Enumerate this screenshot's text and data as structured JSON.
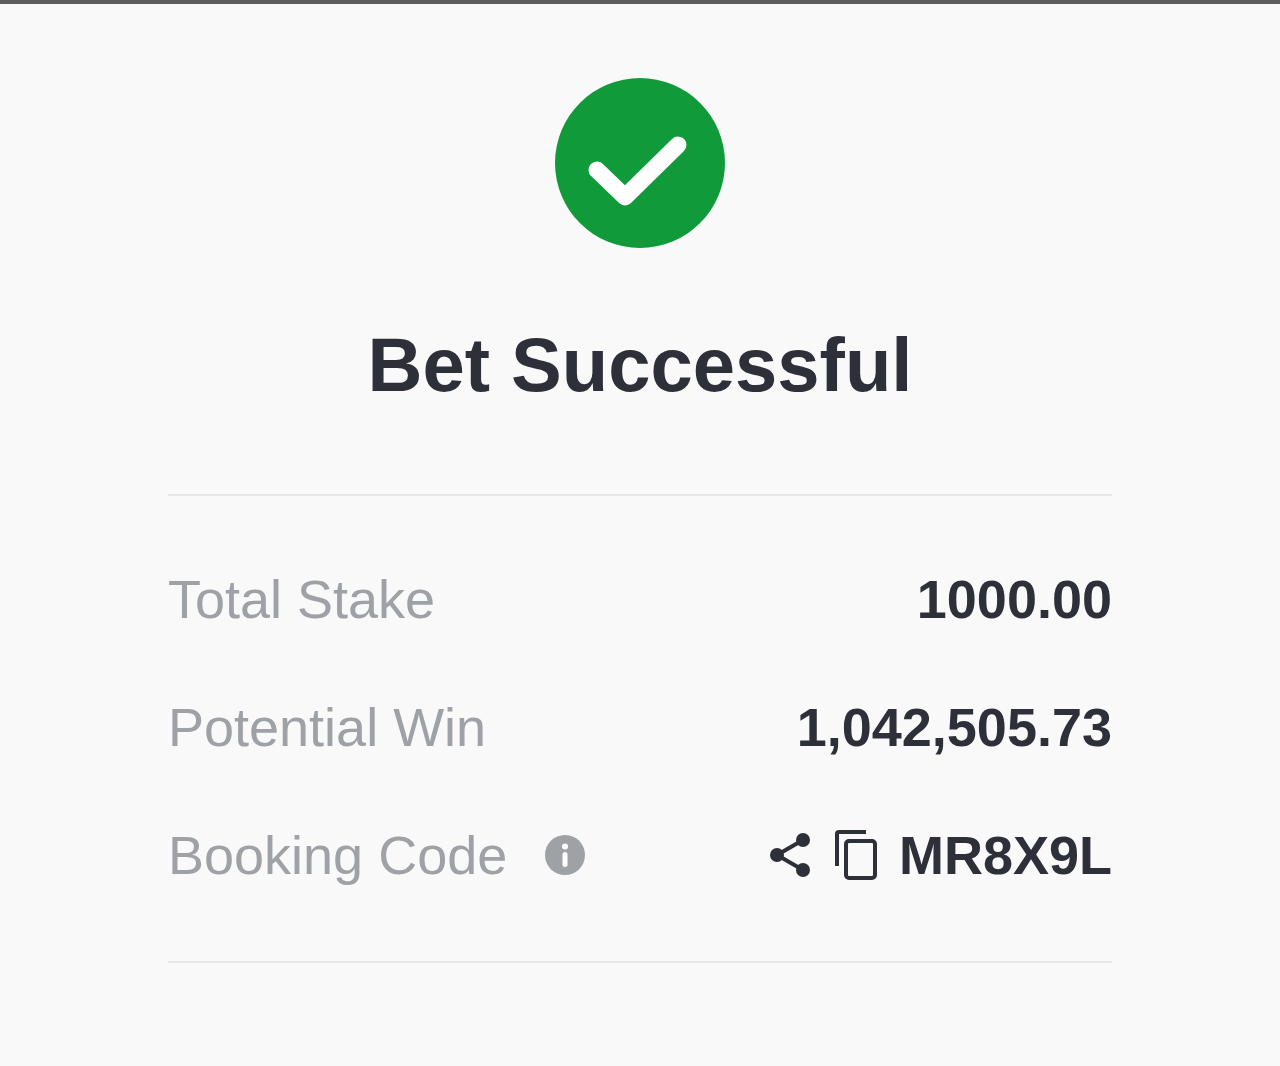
{
  "status": {
    "kind": "success",
    "title": "Bet Successful"
  },
  "details": [
    {
      "kind": "amount",
      "label": "Total Stake",
      "value": "1000.00"
    },
    {
      "kind": "amount",
      "label": "Potential Win",
      "value": "1,042,505.73"
    },
    {
      "kind": "code",
      "label": "Booking Code",
      "value": "MR8X9L"
    }
  ]
}
